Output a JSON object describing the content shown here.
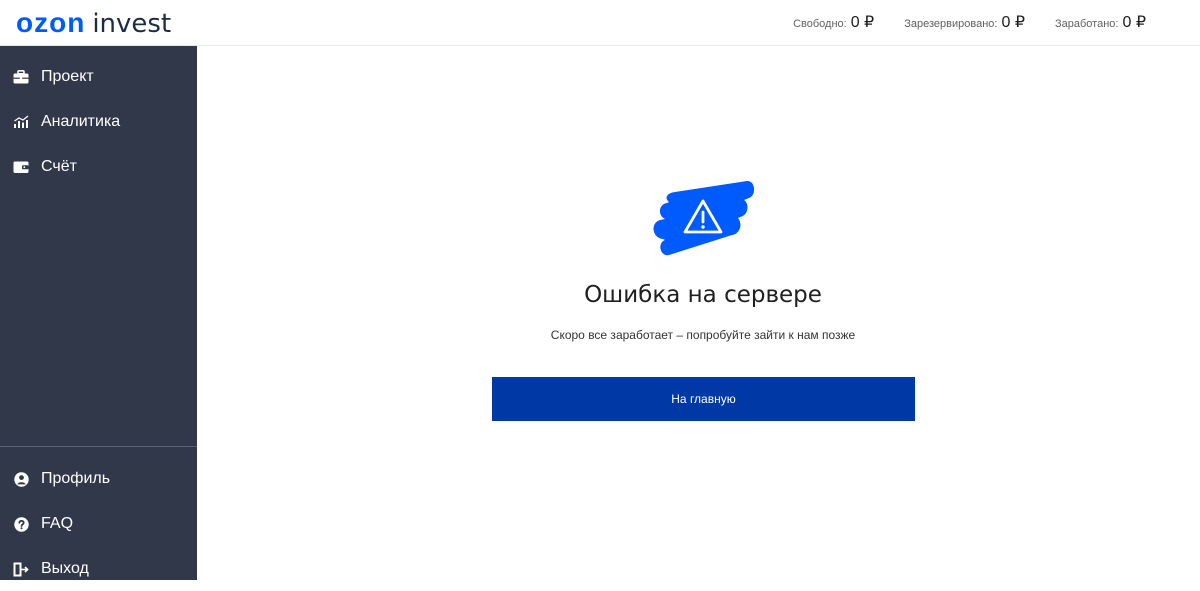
{
  "header": {
    "logo_primary": "ozon",
    "logo_secondary": "invest",
    "balances": [
      {
        "label": "Свободно:",
        "value": "0 ₽"
      },
      {
        "label": "Зарезервировано:",
        "value": "0 ₽"
      },
      {
        "label": "Заработано:",
        "value": "0 ₽"
      }
    ]
  },
  "sidebar": {
    "top_items": [
      {
        "label": "Проект",
        "icon": "briefcase-icon"
      },
      {
        "label": "Аналитика",
        "icon": "bar-chart-icon"
      },
      {
        "label": "Счёт",
        "icon": "wallet-icon"
      }
    ],
    "bottom_items": [
      {
        "label": "Профиль",
        "icon": "user-icon"
      },
      {
        "label": "FAQ",
        "icon": "help-icon"
      },
      {
        "label": "Выход",
        "icon": "logout-icon"
      }
    ]
  },
  "main": {
    "illustration_icon": "warning-icon",
    "title": "Ошибка на сервере",
    "message": "Скоро все заработает – попробуйте зайти к нам позже",
    "home_button_label": "На главную"
  },
  "colors": {
    "brand_blue": "#005bff",
    "button_blue": "#0039a6",
    "sidebar_bg": "#313849"
  }
}
